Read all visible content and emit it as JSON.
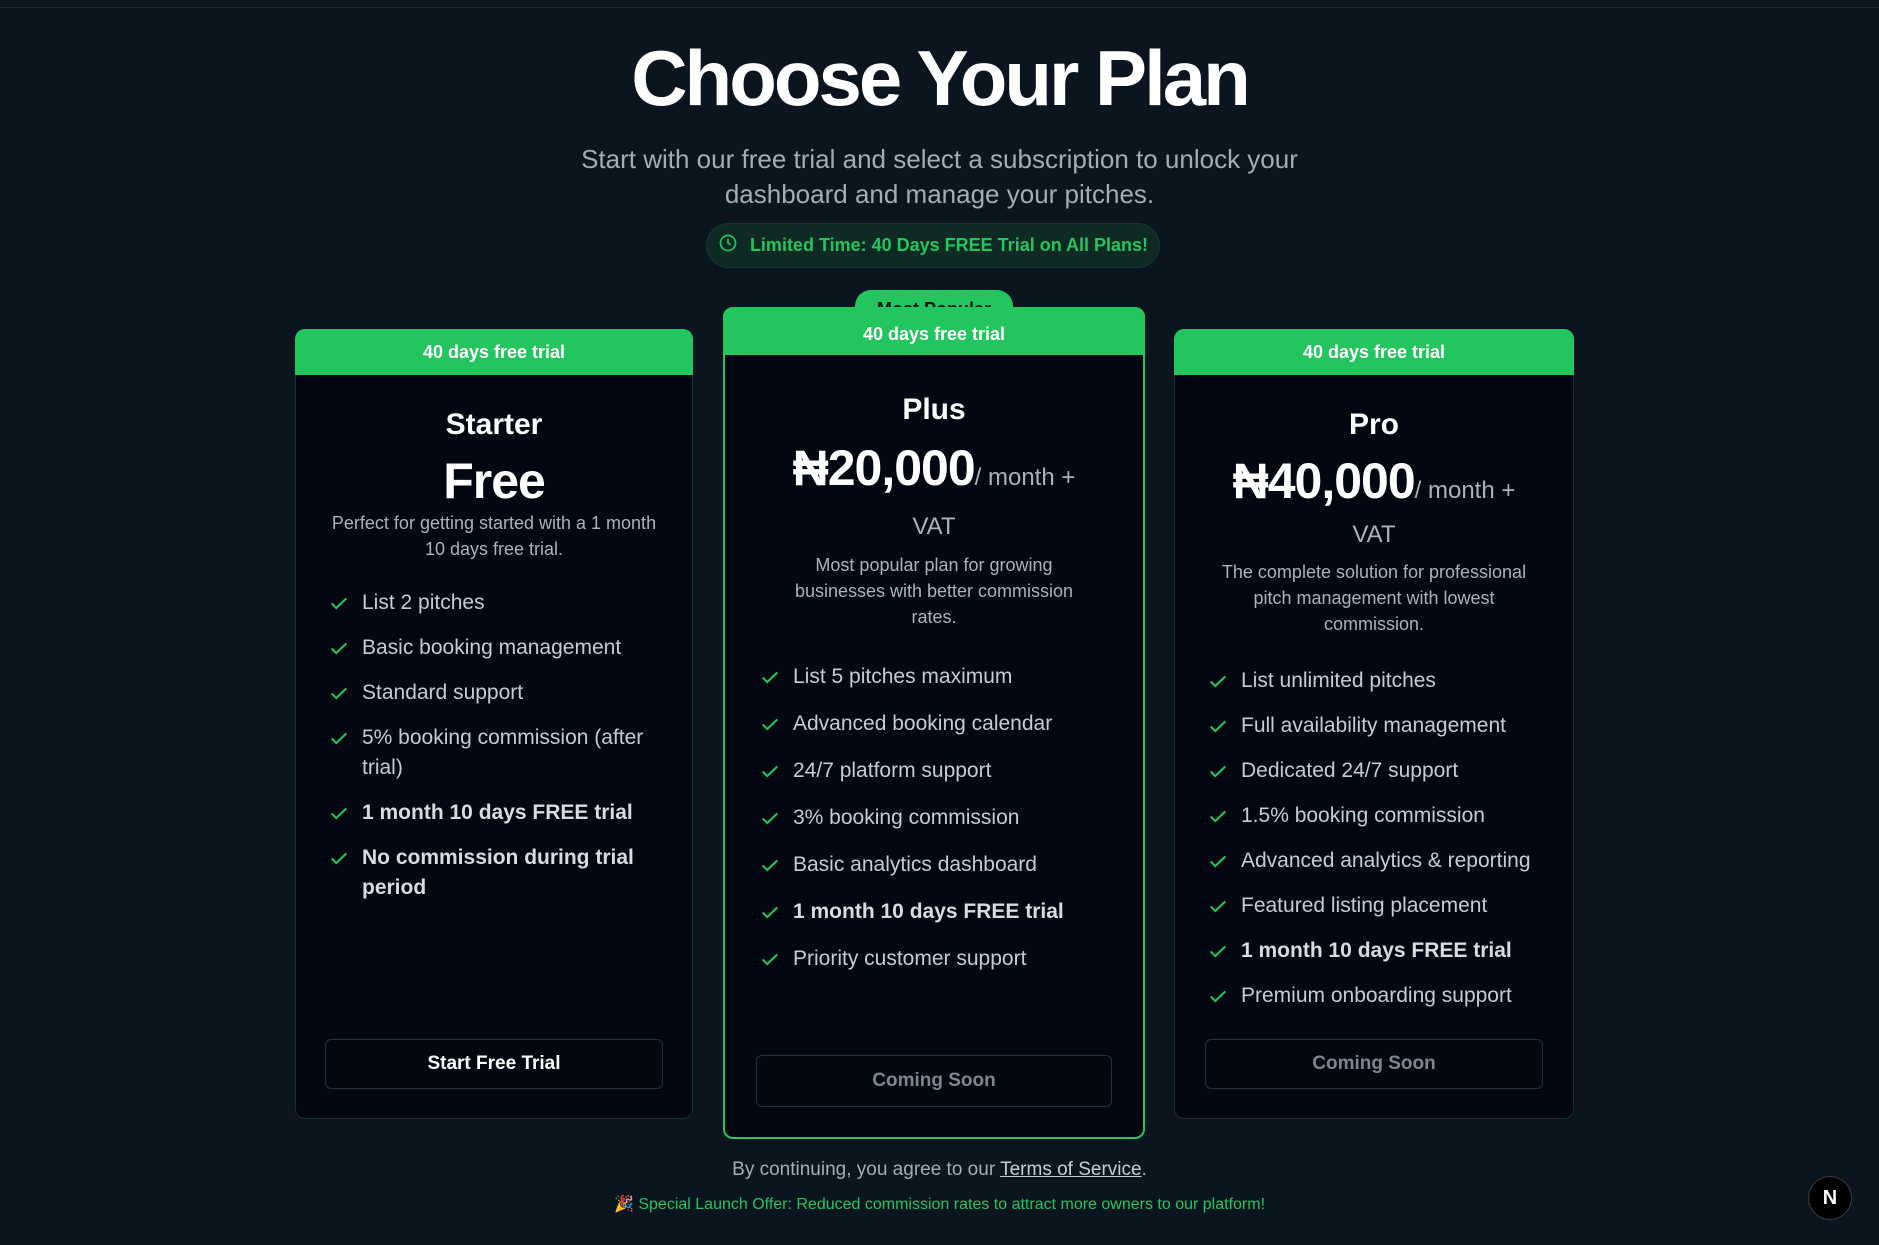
{
  "header": {
    "title": "Choose Your Plan",
    "subtitle": "Start with our free trial and select a subscription to unlock your dashboard and manage your pitches.",
    "promo": "Limited Time: 40 Days FREE Trial on All Plans!"
  },
  "plans": [
    {
      "band": "40 days free trial",
      "name": "Starter",
      "price": "Free",
      "price_suffix": "",
      "vat": "",
      "description": "Perfect for getting started with a 1 month 10 days free trial.",
      "features": [
        "List 2 pitches",
        "Basic booking management",
        "Standard support",
        "5% booking commission (after trial)",
        "1 month 10 days FREE trial",
        "No commission during trial period"
      ],
      "button": "Start Free Trial"
    },
    {
      "badge": "Most Popular",
      "band": "40 days free trial",
      "name": "Plus",
      "price": "₦20,000",
      "price_suffix": "/ month +",
      "vat": "VAT",
      "description": "Most popular plan for growing businesses with better commission rates.",
      "features": [
        "List 5 pitches maximum",
        "Advanced booking calendar",
        "24/7 platform support",
        "3% booking commission",
        "Basic analytics dashboard",
        "1 month 10 days FREE trial",
        "Priority customer support"
      ],
      "button": "Coming Soon"
    },
    {
      "band": "40 days free trial",
      "name": "Pro",
      "price": "₦40,000",
      "price_suffix": "/ month +",
      "vat": "VAT",
      "description": "The complete solution for professional pitch management with lowest commission.",
      "features": [
        "List unlimited pitches",
        "Full availability management",
        "Dedicated 24/7 support",
        "1.5% booking commission",
        "Advanced analytics & reporting",
        "Featured listing placement",
        "1 month 10 days FREE trial",
        "Premium onboarding support"
      ],
      "button": "Coming Soon"
    }
  ],
  "footer": {
    "prefix": "By continuing, you agree to our ",
    "link": "Terms of Service",
    "suffix": ".",
    "launch": "🎉 Special Launch Offer: Reduced commission rates to attract more owners to our platform!"
  },
  "dev_badge": "N",
  "colors": {
    "accent": "#22c55e",
    "background": "#0a1520",
    "card": "#020712"
  }
}
